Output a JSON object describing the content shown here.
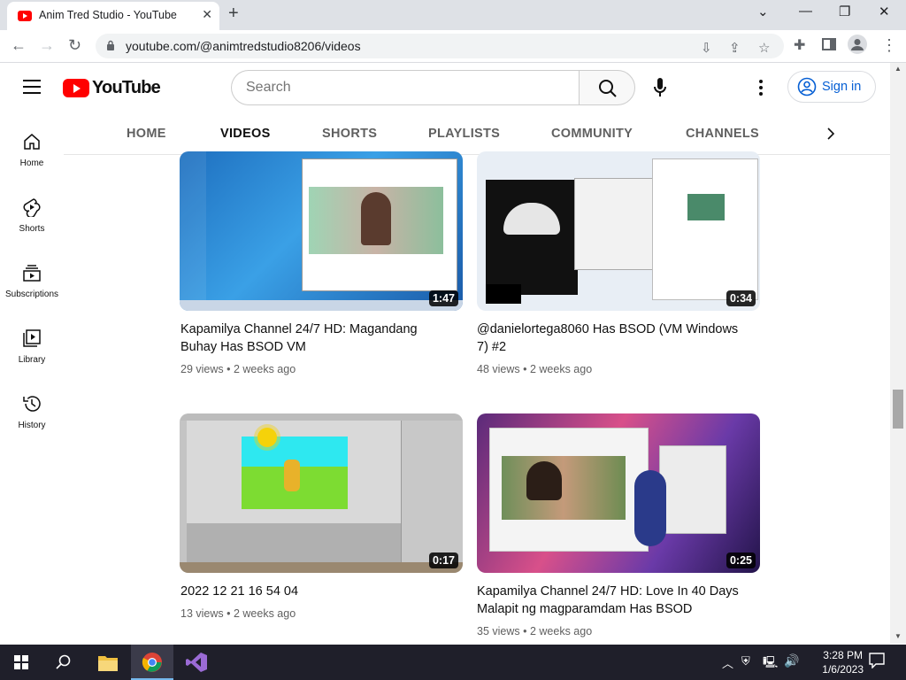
{
  "browser": {
    "tab_title": "Anim Tred Studio - YouTube",
    "url": "youtube.com/@animtredstudio8206/videos"
  },
  "youtube": {
    "logo_text": "YouTube",
    "search_placeholder": "Search",
    "sign_in": "Sign in",
    "sidebar": [
      {
        "label": "Home",
        "icon": "home-icon"
      },
      {
        "label": "Shorts",
        "icon": "shorts-icon"
      },
      {
        "label": "Subscriptions",
        "icon": "subscriptions-icon"
      },
      {
        "label": "Library",
        "icon": "library-icon"
      },
      {
        "label": "History",
        "icon": "history-icon"
      }
    ],
    "channel_tabs": [
      "HOME",
      "VIDEOS",
      "SHORTS",
      "PLAYLISTS",
      "COMMUNITY",
      "CHANNELS"
    ],
    "active_tab": "VIDEOS",
    "videos": [
      {
        "title": "Kapamilya Channel 24/7 HD: Magandang Buhay Has BSOD VM",
        "duration": "1:47",
        "views": "29 views",
        "age": "2 weeks ago"
      },
      {
        "title": "@danielortega8060 Has BSOD (VM Windows 7) #2",
        "duration": "0:34",
        "views": "48 views",
        "age": "2 weeks ago"
      },
      {
        "title": "2022 12 21 16 54 04",
        "duration": "0:17",
        "views": "13 views",
        "age": "2 weeks ago"
      },
      {
        "title": "Kapamilya Channel 24/7 HD: Love In 40 Days Malapit ng magparamdam Has BSOD",
        "duration": "0:25",
        "views": "35 views",
        "age": "2 weeks ago"
      }
    ]
  },
  "taskbar": {
    "time": "3:28 PM",
    "date": "1/6/2023"
  }
}
